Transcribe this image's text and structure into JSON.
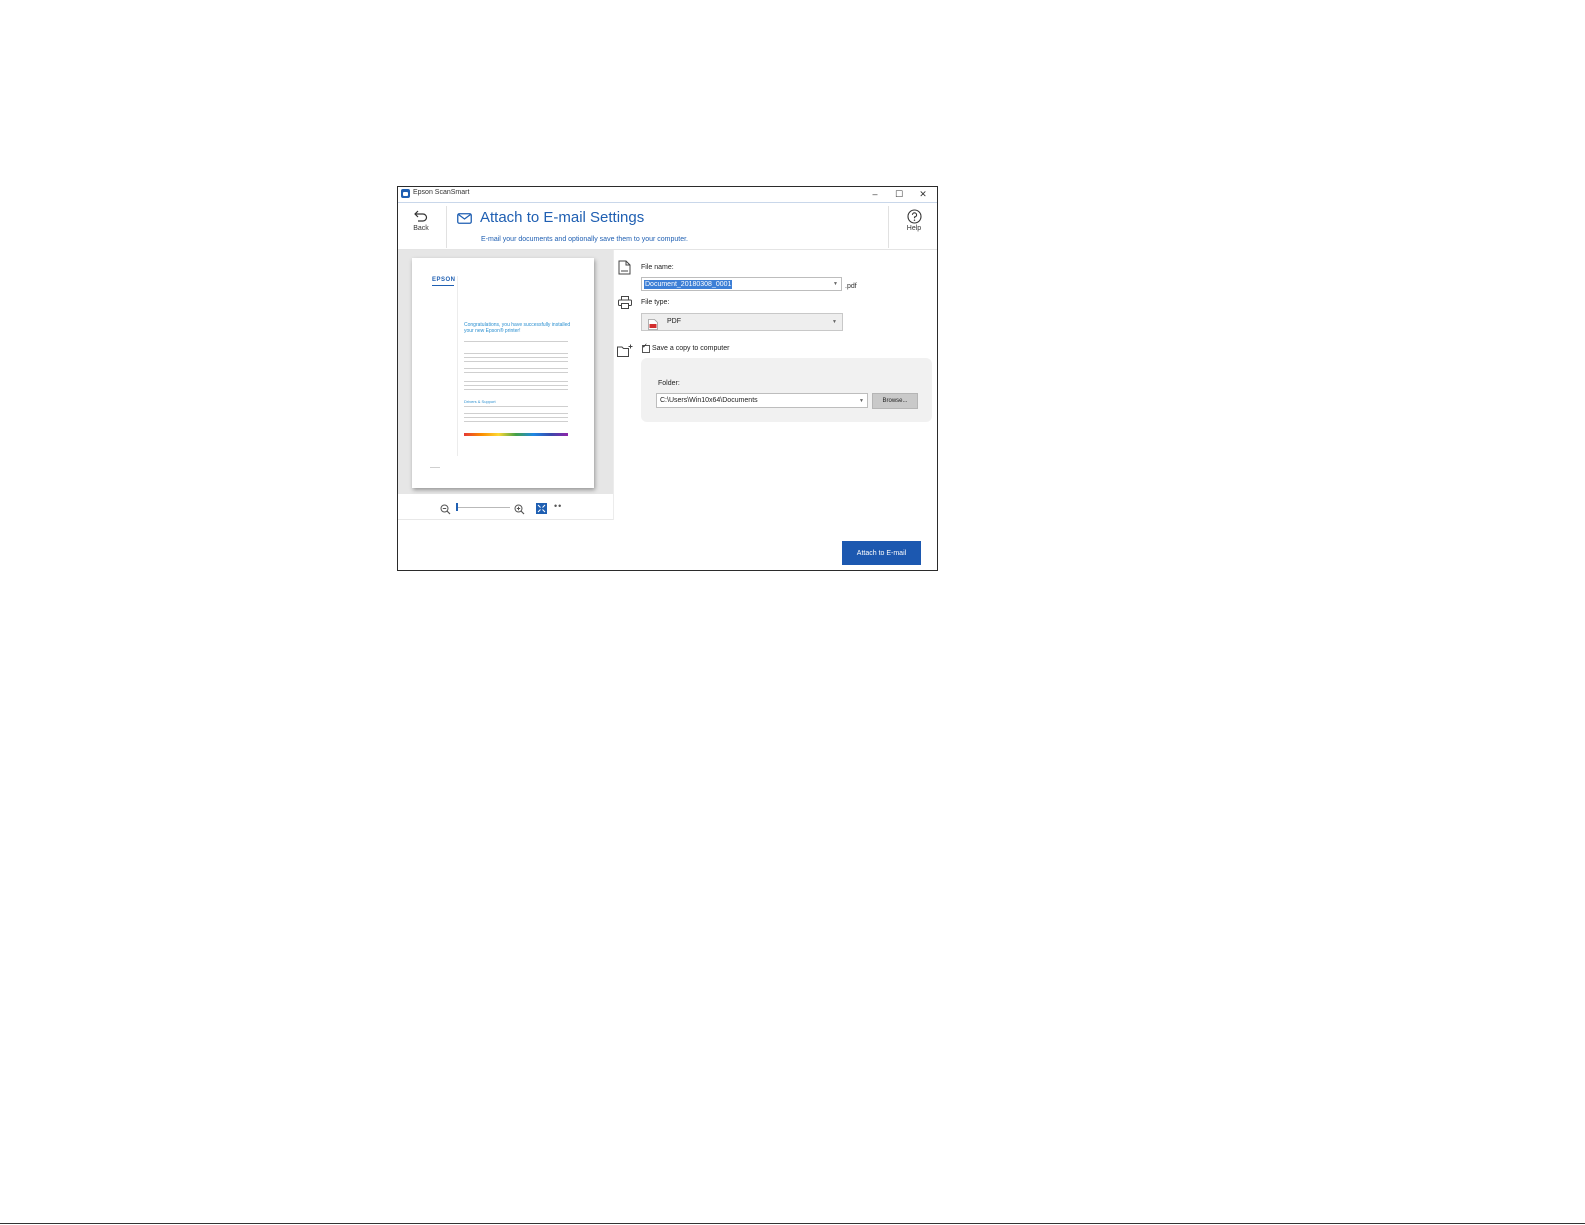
{
  "window": {
    "app_title": "Epson ScanSmart",
    "minimize_glyph": "–",
    "maximize_glyph": "☐",
    "close_glyph": "✕"
  },
  "header": {
    "back_label": "Back",
    "title": "Attach to E-mail Settings",
    "subtitle": "E-mail your documents and optionally save them to your computer.",
    "help_label": "Help"
  },
  "preview": {
    "logo_text": "EPSON",
    "heading": "Congratulations, you have successfully installed your new Epson® printer!",
    "subheading": "Drivers & Support",
    "more_glyph": "••"
  },
  "form": {
    "file_name_label": "File name:",
    "file_name_value": "Document_20180308_0001",
    "file_extension": ".pdf",
    "file_type_label": "File type:",
    "file_type_value": "PDF",
    "save_copy_label": "Save a copy to computer",
    "save_copy_checked": true,
    "checkmark_glyph": "✓",
    "folder_label": "Folder:",
    "folder_value": "C:\\Users\\Win10x64\\Documents",
    "browse_label": "Browse...",
    "dropdown_glyph": "▼"
  },
  "footer": {
    "attach_label": "Attach to E-mail"
  },
  "colors": {
    "accent": "#1f5fb2",
    "primary_button": "#1c58b0",
    "selection": "#3d7fd6"
  },
  "icons": [
    "back-arrow-icon",
    "mail-icon",
    "help-icon",
    "document-icon",
    "printer-icon",
    "folder-add-icon",
    "pdf-icon",
    "zoom-out-icon",
    "zoom-in-icon",
    "fit-page-icon",
    "more-icon"
  ]
}
